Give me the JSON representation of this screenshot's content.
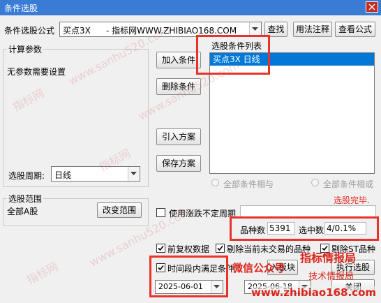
{
  "window": {
    "title": "条件选股"
  },
  "formula": {
    "label": "条件选股公式",
    "name": "买点3X",
    "desc": " - 指标网WWW.ZHIBIAO168.COM",
    "find_btn": "查找",
    "usage_btn": "用法注释",
    "view_btn": "查看公式"
  },
  "params": {
    "title": "计算参数",
    "text": "无参数需要设置",
    "period_label": "选股周期:",
    "period_value": "日线"
  },
  "buttons": {
    "add": "加入条件",
    "delete": "删除条件",
    "import": "引入方案",
    "save": "保存方案"
  },
  "conditions": {
    "title": "选股条件列表",
    "items": [
      "买点3X  日线"
    ]
  },
  "logic": {
    "and_label": "全部条件相与",
    "or_label": "全部条件相或"
  },
  "status": {
    "done": "选股完毕."
  },
  "range": {
    "title": "选股范围",
    "value": "全部A股",
    "change_btn": "改变范围"
  },
  "options": {
    "volatile_label": "使用涨跌不定周期",
    "count_label": "品种数",
    "count_value": "5391",
    "selected_label": "选中数",
    "selected_value": "4/0.1%",
    "adjust_label": "前复权数据",
    "exclude_untraded_label": "剔除当前未交易的品种",
    "exclude_st_label": "剔除ST品种",
    "time_label": "时间段内满足条件",
    "date_start": "2025-06-01",
    "date_end": "2025-06-18"
  },
  "actions": {
    "add_to_block": "入板块",
    "execute": "执行选股",
    "close": "关闭"
  },
  "overlay": {
    "wechat": "微信公众号",
    "brand": "指标情报局",
    "slogan": "技术情报局",
    "site": "www.zhibiao168.com"
  },
  "watermarks": [
    "指标网",
    "www.sanhu520.com",
    "指标网",
    "www.sanhu520.com",
    "指标网",
    "www.sanhu520.com"
  ],
  "colors": {
    "accent": "#e8332a",
    "selection": "#0078d7",
    "status_red": "#e8332a"
  }
}
